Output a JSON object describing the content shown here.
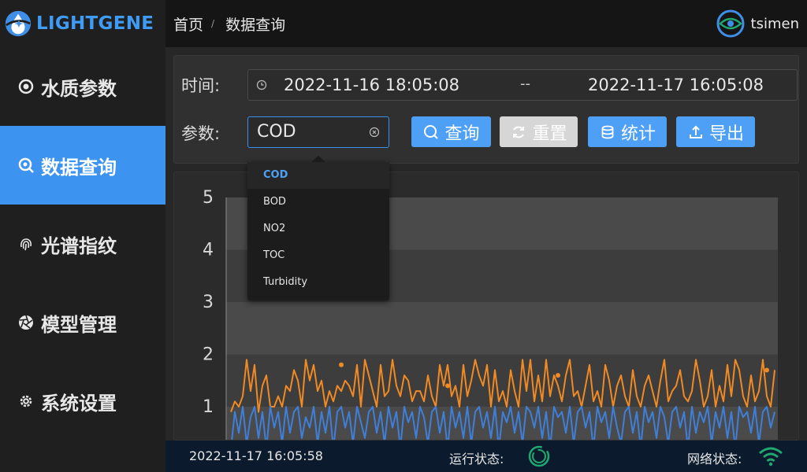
{
  "brand": {
    "name": "LIGHTGENE",
    "logo_icon": "droplet-logo-icon"
  },
  "sidebar": {
    "items": [
      {
        "label": "水质参数",
        "icon": "water-quality-icon",
        "active": false
      },
      {
        "label": "数据查询",
        "icon": "search-data-icon",
        "active": true
      },
      {
        "label": "光谱指纹",
        "icon": "fingerprint-icon",
        "active": false
      },
      {
        "label": "模型管理",
        "icon": "aperture-icon",
        "active": false
      },
      {
        "label": "系统设置",
        "icon": "gear-icon",
        "active": false
      }
    ]
  },
  "header": {
    "breadcrumb": [
      "首页",
      "数据查询"
    ],
    "separator": "/",
    "user": "tsimen"
  },
  "query": {
    "time_label": "时间:",
    "start": "2022-11-16 18:05:08",
    "range_separator": "--",
    "end": "2022-11-17 16:05:08",
    "param_label": "参数:",
    "param_value": "COD",
    "buttons": {
      "search": "查询",
      "reset": "重置",
      "stats": "统计",
      "export": "导出"
    }
  },
  "dropdown": {
    "options": [
      "COD",
      "BOD",
      "NO2",
      "TOC",
      "Turbidity"
    ],
    "selected": "COD"
  },
  "chart_data": {
    "type": "line",
    "y_ticks": [
      "5",
      "4",
      "3",
      "2",
      "1"
    ],
    "ylim": [
      0,
      5
    ],
    "series": [
      {
        "color": "#f08a24",
        "values": [
          0.9,
          1.1,
          1.0,
          1.2,
          1.9,
          1.3,
          1.8,
          0.9,
          1.4,
          1.6,
          1.0,
          1.0,
          1.2,
          1.0,
          1.4,
          1.3,
          1.7,
          1.5,
          1.0,
          1.9,
          1.5,
          1.8,
          1.3,
          1.5,
          1.0,
          1.3,
          1.1,
          1.4,
          1.3,
          1.5,
          1.4,
          1.2,
          1.8,
          1.0,
          1.9,
          1.6,
          1.3,
          1.0,
          1.8,
          1.2,
          1.3,
          1.9,
          1.4,
          1.2,
          1.6,
          1.5,
          1.1,
          1.3,
          1.3,
          1.1,
          1.6,
          1.2,
          1.0,
          1.8,
          1.4,
          1.8,
          1.2,
          1.4,
          1.0,
          1.8,
          1.2,
          1.5,
          1.9,
          1.6,
          1.4,
          1.8,
          1.0,
          1.7,
          1.1,
          1.3,
          1.0,
          1.7,
          1.3,
          1.0,
          1.9,
          1.3,
          1.9,
          1.1,
          1.6,
          1.1,
          1.9,
          1.2,
          1.6,
          1.4,
          1.1,
          1.6,
          1.9,
          1.2,
          1.3,
          1.0,
          1.4,
          1.8,
          1.1,
          1.3,
          1.0,
          1.8,
          1.5,
          1.0,
          1.4,
          1.6,
          1.2,
          1.0,
          1.7,
          1.2,
          1.0,
          1.4,
          1.6,
          1.3,
          1.0,
          1.5,
          1.9,
          1.1,
          1.3,
          1.4,
          1.7,
          1.2,
          1.1,
          1.3,
          1.9,
          1.5,
          1.0,
          1.2,
          1.7,
          1.0,
          1.4,
          1.1,
          1.8,
          1.2,
          1.9,
          1.7,
          1.2,
          1.0,
          1.6,
          1.1,
          1.3,
          1.9,
          1.2,
          1.0,
          1.7
        ],
        "markers": [
          {
            "index": 28,
            "value": 1.8
          },
          {
            "index": 55,
            "value": 1.4
          },
          {
            "index": 83,
            "value": 1.6
          },
          {
            "index": 136,
            "value": 1.7
          }
        ]
      },
      {
        "color": "#3f7fd9",
        "values": [
          0.2,
          0.9,
          0.5,
          1.0,
          0.3,
          0.8,
          1.0,
          0.4,
          0.9,
          0.2,
          1.0,
          0.6,
          0.9,
          0.3,
          1.0,
          0.5,
          0.9,
          1.0,
          0.4,
          0.8,
          0.6,
          1.0,
          0.3,
          0.9,
          0.5,
          1.0,
          0.2,
          0.9,
          1.0,
          0.6,
          0.9,
          0.3,
          1.0,
          0.7,
          0.4,
          0.9,
          1.0,
          0.5,
          0.9,
          0.3,
          1.0,
          0.6,
          0.9,
          0.2,
          1.0,
          0.7,
          0.9,
          0.4,
          1.0,
          0.8,
          0.3,
          0.9,
          1.0,
          0.5,
          0.9,
          0.2,
          1.0,
          0.6,
          0.9,
          0.4,
          1.0,
          0.3,
          0.9,
          1.0,
          0.6,
          0.9,
          0.4,
          1.0,
          0.2,
          0.9,
          0.7,
          1.0,
          0.5,
          0.9,
          0.3,
          1.0,
          0.9,
          0.6,
          1.0,
          0.4,
          0.9,
          0.2,
          1.0,
          0.8,
          0.9,
          0.5,
          1.0,
          0.3,
          0.9,
          1.0,
          0.6,
          0.9,
          0.2,
          1.0,
          0.7,
          0.9,
          0.4,
          1.0,
          0.6,
          0.3,
          0.9,
          1.0,
          0.5,
          0.9,
          0.2,
          1.0,
          0.7,
          0.9,
          0.4,
          1.0,
          0.8,
          0.3,
          0.9,
          1.0,
          0.6,
          0.9,
          0.2,
          1.0,
          0.5,
          0.9,
          0.7,
          1.0,
          0.3,
          0.9,
          0.6,
          1.0,
          0.4,
          0.9,
          0.2,
          1.0,
          0.8,
          0.9,
          0.5,
          1.0,
          0.3,
          0.9,
          1.0,
          0.6,
          0.9
        ]
      }
    ]
  },
  "status": {
    "time": "2022-11-17 16:05:58",
    "run_label": "运行状态:",
    "run_icon": "spinner-ring-icon",
    "net_label": "网络状态:",
    "net_icon": "wifi-icon",
    "ok_color": "#1fa971"
  }
}
